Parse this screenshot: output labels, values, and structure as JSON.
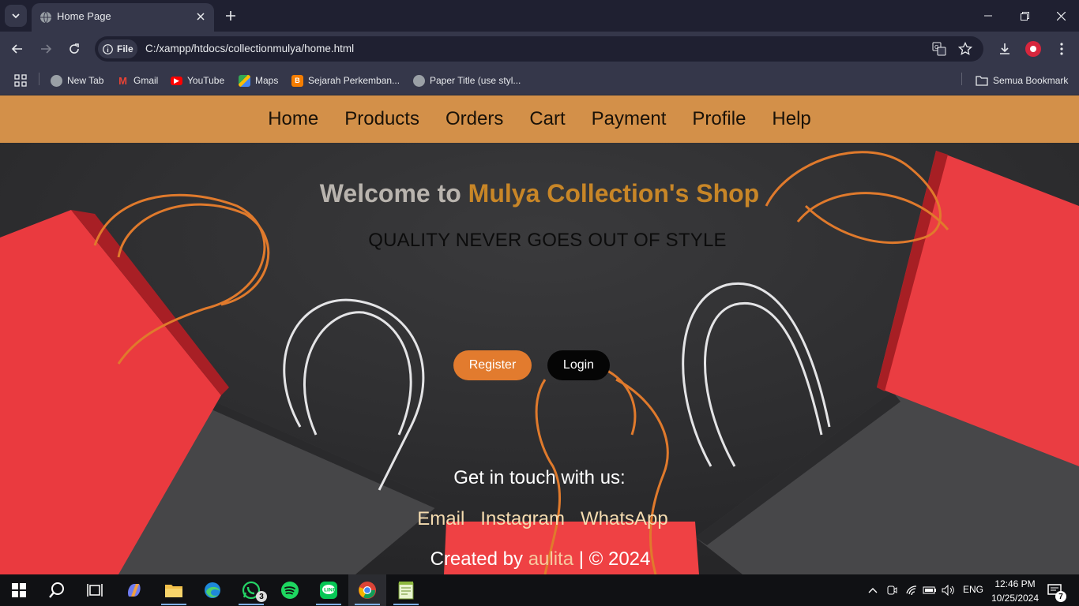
{
  "browser": {
    "tab_title": "Home Page",
    "chip_label": "File",
    "url": "C:/xampp/htdocs/collectionmulya/home.html",
    "bookmarks": [
      {
        "label": "New Tab",
        "icon": "globe-icon"
      },
      {
        "label": "Gmail",
        "icon": "gmail-icon"
      },
      {
        "label": "YouTube",
        "icon": "youtube-icon"
      },
      {
        "label": "Maps",
        "icon": "maps-icon"
      },
      {
        "label": "Sejarah Perkemban...",
        "icon": "blogger-icon"
      },
      {
        "label": "Paper Title (use styl...",
        "icon": "globe-icon"
      }
    ],
    "all_bookmarks_label": "Semua Bookmark"
  },
  "page": {
    "nav": [
      "Home",
      "Products",
      "Orders",
      "Cart",
      "Payment",
      "Profile",
      "Help"
    ],
    "welcome_prefix": "Welcome to ",
    "welcome_brand": "Mulya Collection's Shop",
    "tagline": "QUALITY NEVER GOES OUT OF STYLE",
    "register_label": "Register",
    "login_label": "Login",
    "contact_heading": "Get in touch with us:",
    "contact_links": [
      "Email",
      "Instagram",
      "WhatsApp"
    ],
    "credit_prefix": "Created by ",
    "credit_author": "aulita",
    "credit_suffix": " | © 2024"
  },
  "colors": {
    "nav_bg": "#d39049",
    "brand": "#c88627",
    "register_bg": "#e27b2e",
    "login_bg": "#050505"
  },
  "taskbar": {
    "whatsapp_badge": "3",
    "language": "ENG",
    "time": "12:46 PM",
    "date": "10/25/2024",
    "notification_count": "7"
  }
}
